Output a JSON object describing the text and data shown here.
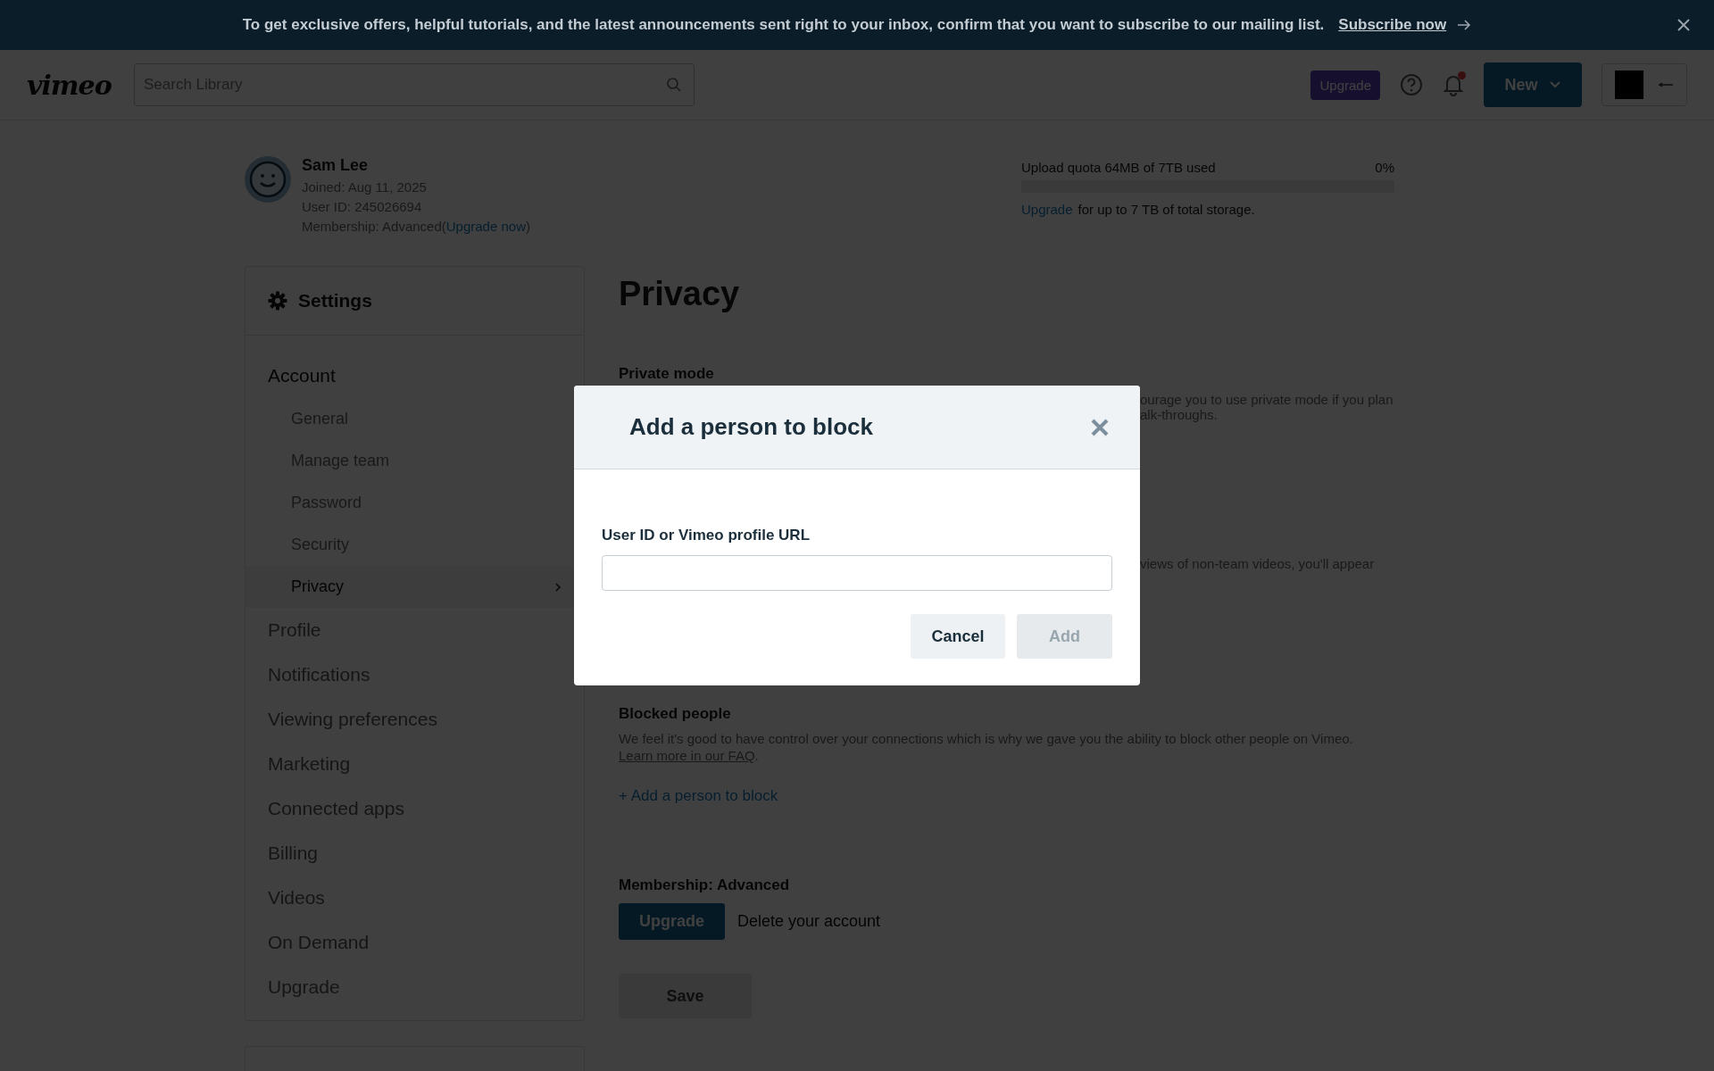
{
  "banner": {
    "text": "To get exclusive offers, helpful tutorials, and the latest announcements sent right to your inbox, confirm that you want to subscribe to our mailing list.",
    "link": "Subscribe now"
  },
  "header": {
    "logo": "vimeo",
    "search": {
      "placeholder": "Search Library"
    },
    "upgrade": "Upgrade",
    "unread": true,
    "new_button": "New"
  },
  "profile": {
    "name": "Sam Lee",
    "joined": "Joined: Aug 11, 2025",
    "user_id": "User ID: 245026694",
    "membership": "Membership: Advanced(",
    "membership_link": "Upgrade now",
    "membership_end": ")"
  },
  "quota": {
    "label": "Upload quota 64MB of 7TB used",
    "percent": "0%",
    "level": 0,
    "link": "Upgrade",
    "note": "for up to 7 TB of total storage."
  },
  "sidebar": {
    "title": "Settings",
    "items": [
      {
        "label": "Account",
        "selected": false,
        "children": [
          {
            "label": "General",
            "selected": false
          },
          {
            "label": "Manage team",
            "selected": false
          },
          {
            "label": "Password",
            "selected": false
          },
          {
            "label": "Security",
            "selected": false
          },
          {
            "label": "Privacy",
            "selected": true
          }
        ]
      },
      {
        "label": "Profile",
        "selected": false
      },
      {
        "label": "Notifications",
        "selected": false
      },
      {
        "label": "Viewing preferences",
        "selected": false
      },
      {
        "label": "Marketing",
        "selected": false
      },
      {
        "label": "Connected apps",
        "selected": false
      },
      {
        "label": "Billing",
        "selected": false
      },
      {
        "label": "Videos",
        "selected": false
      },
      {
        "label": "On Demand",
        "selected": false
      },
      {
        "label": "Upgrade",
        "selected": false
      }
    ]
  },
  "main": {
    "title": "Privacy",
    "private_mode": {
      "heading": "Private mode",
      "fragments": [
        "ourage you to use private mode if you plan",
        "alk-throughs."
      ]
    },
    "fragment_2": "views of non-team videos, you'll appear",
    "blocked": {
      "heading": "Blocked people",
      "text": "We feel it's good to have control over your connections which is why we gave you the ability to block other people on Vimeo.",
      "faq_link": "Learn more in our FAQ",
      "faq_end": ".",
      "add_link": "+ Add a person to block"
    },
    "membership": {
      "heading": "Membership: Advanced",
      "upgrade": "Upgrade",
      "delete": "Delete your account"
    },
    "save": {
      "label": "Save",
      "disabled": true
    }
  },
  "modal": {
    "title": "Add a person to block",
    "field_label": "User ID or Vimeo profile URL",
    "cancel": "Cancel",
    "add": {
      "label": "Add",
      "disabled": true
    }
  }
}
